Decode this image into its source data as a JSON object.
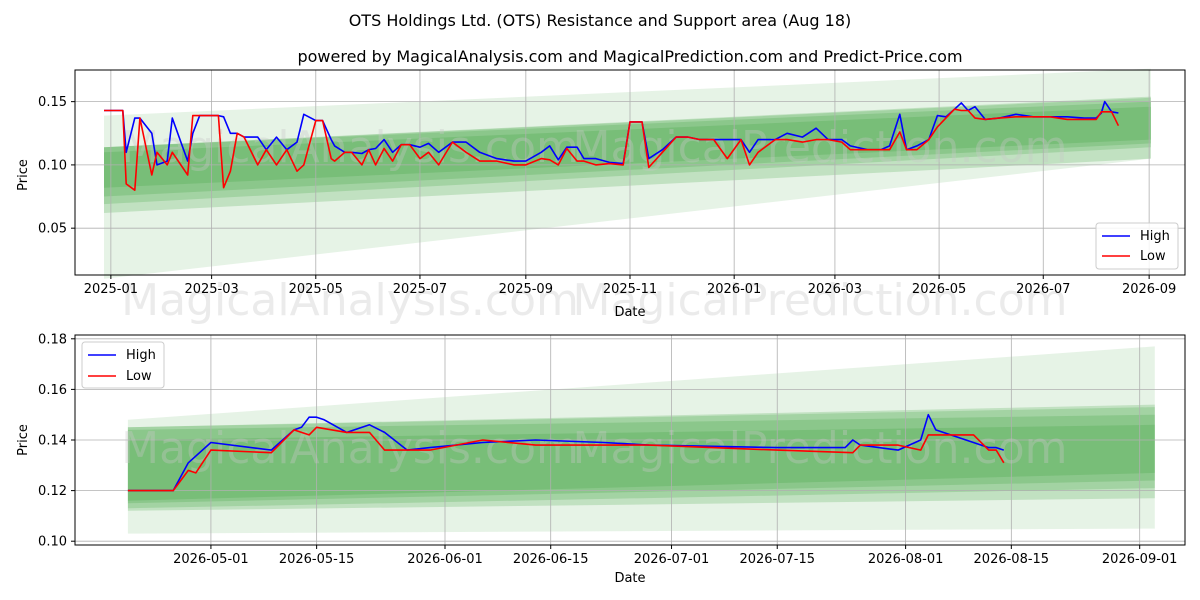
{
  "title": "OTS Holdings Ltd. (OTS) Resistance and Support area (Aug 18)",
  "subtitle": "powered by MagicalAnalysis.com and MagicalPrediction.com and Predict-Price.com",
  "watermarks": [
    "MagicalAnalysis.com",
    "MagicalPrediction.com"
  ],
  "colors": {
    "high": "#0000ff",
    "low": "#ff0000",
    "band": "#2e9a2e",
    "grid": "#b0b0b0"
  },
  "chart_data": [
    {
      "type": "line",
      "xlabel": "Date",
      "ylabel": "Price",
      "xlim": [
        "2024-12-11",
        "2026-09-22"
      ],
      "ylim": [
        0.013,
        0.175
      ],
      "grid": true,
      "legend_placement": "bottom-right",
      "x_ticks": [
        "2025-01",
        "2025-03",
        "2025-05",
        "2025-07",
        "2025-09",
        "2025-11",
        "2026-01",
        "2026-03",
        "2026-05",
        "2026-07",
        "2026-09"
      ],
      "y_ticks": [
        "0.05",
        "0.10",
        "0.15"
      ],
      "series": [
        {
          "name": "High",
          "x": [
            "2024-12-28",
            "2025-01-08",
            "2025-01-10",
            "2025-01-15",
            "2025-01-18",
            "2025-01-25",
            "2025-01-28",
            "2025-02-03",
            "2025-02-06",
            "2025-02-15",
            "2025-02-18",
            "2025-02-22",
            "2025-03-05",
            "2025-03-08",
            "2025-03-12",
            "2025-03-16",
            "2025-03-20",
            "2025-03-28",
            "2025-04-02",
            "2025-04-08",
            "2025-04-14",
            "2025-04-20",
            "2025-04-24",
            "2025-05-01",
            "2025-05-05",
            "2025-05-10",
            "2025-05-12",
            "2025-05-18",
            "2025-05-22",
            "2025-05-28",
            "2025-06-01",
            "2025-06-05",
            "2025-06-10",
            "2025-06-15",
            "2025-06-20",
            "2025-06-25",
            "2025-07-01",
            "2025-07-06",
            "2025-07-12",
            "2025-07-20",
            "2025-07-28",
            "2025-08-05",
            "2025-08-15",
            "2025-08-25",
            "2025-09-01",
            "2025-09-10",
            "2025-09-15",
            "2025-09-20",
            "2025-09-25",
            "2025-10-01",
            "2025-10-05",
            "2025-10-12",
            "2025-10-20",
            "2025-10-28",
            "2025-11-01",
            "2025-11-08",
            "2025-11-12",
            "2025-11-20",
            "2025-11-28",
            "2025-12-05",
            "2025-12-12",
            "2025-12-20",
            "2025-12-28",
            "2026-01-05",
            "2026-01-10",
            "2026-01-15",
            "2026-01-25",
            "2026-02-01",
            "2026-02-10",
            "2026-02-18",
            "2026-02-25",
            "2026-03-05",
            "2026-03-10",
            "2026-03-20",
            "2026-03-28",
            "2026-04-02",
            "2026-04-08",
            "2026-04-12",
            "2026-04-18",
            "2026-04-25",
            "2026-04-30",
            "2026-05-05",
            "2026-05-10",
            "2026-05-14",
            "2026-05-18",
            "2026-05-22",
            "2026-05-28",
            "2026-06-05",
            "2026-06-15",
            "2026-06-25",
            "2026-07-05",
            "2026-07-15",
            "2026-07-25",
            "2026-08-01",
            "2026-08-04",
            "2026-08-06",
            "2026-08-10",
            "2026-08-14"
          ],
          "values": [
            0.143,
            0.143,
            0.11,
            0.137,
            0.137,
            0.125,
            0.1,
            0.103,
            0.137,
            0.103,
            0.125,
            0.139,
            0.139,
            0.138,
            0.125,
            0.125,
            0.122,
            0.122,
            0.112,
            0.122,
            0.112,
            0.118,
            0.14,
            0.135,
            0.135,
            0.12,
            0.115,
            0.11,
            0.11,
            0.109,
            0.112,
            0.113,
            0.12,
            0.11,
            0.116,
            0.116,
            0.114,
            0.117,
            0.11,
            0.118,
            0.118,
            0.11,
            0.105,
            0.103,
            0.103,
            0.11,
            0.115,
            0.104,
            0.114,
            0.114,
            0.105,
            0.105,
            0.102,
            0.101,
            0.134,
            0.134,
            0.105,
            0.112,
            0.122,
            0.122,
            0.12,
            0.12,
            0.12,
            0.12,
            0.11,
            0.12,
            0.12,
            0.125,
            0.122,
            0.129,
            0.12,
            0.12,
            0.115,
            0.112,
            0.112,
            0.115,
            0.14,
            0.112,
            0.115,
            0.12,
            0.139,
            0.138,
            0.144,
            0.149,
            0.143,
            0.146,
            0.136,
            0.137,
            0.14,
            0.138,
            0.138,
            0.138,
            0.137,
            0.137,
            0.141,
            0.15,
            0.142,
            0.141
          ]
        },
        {
          "name": "Low",
          "x": [
            "2024-12-28",
            "2025-01-08",
            "2025-01-10",
            "2025-01-15",
            "2025-01-18",
            "2025-01-25",
            "2025-01-28",
            "2025-02-03",
            "2025-02-06",
            "2025-02-15",
            "2025-02-18",
            "2025-02-22",
            "2025-03-05",
            "2025-03-08",
            "2025-03-12",
            "2025-03-16",
            "2025-03-20",
            "2025-03-28",
            "2025-04-02",
            "2025-04-08",
            "2025-04-14",
            "2025-04-20",
            "2025-04-24",
            "2025-05-01",
            "2025-05-05",
            "2025-05-10",
            "2025-05-12",
            "2025-05-18",
            "2025-05-22",
            "2025-05-28",
            "2025-06-01",
            "2025-06-05",
            "2025-06-10",
            "2025-06-15",
            "2025-06-20",
            "2025-06-25",
            "2025-07-01",
            "2025-07-06",
            "2025-07-12",
            "2025-07-20",
            "2025-07-28",
            "2025-08-05",
            "2025-08-15",
            "2025-08-25",
            "2025-09-01",
            "2025-09-10",
            "2025-09-15",
            "2025-09-20",
            "2025-09-25",
            "2025-10-01",
            "2025-10-05",
            "2025-10-12",
            "2025-10-20",
            "2025-10-28",
            "2025-11-01",
            "2025-11-08",
            "2025-11-12",
            "2025-11-20",
            "2025-11-28",
            "2025-12-05",
            "2025-12-12",
            "2025-12-20",
            "2025-12-28",
            "2026-01-05",
            "2026-01-10",
            "2026-01-15",
            "2026-01-25",
            "2026-02-01",
            "2026-02-10",
            "2026-02-18",
            "2026-02-25",
            "2026-03-05",
            "2026-03-10",
            "2026-03-20",
            "2026-03-28",
            "2026-04-02",
            "2026-04-08",
            "2026-04-12",
            "2026-04-18",
            "2026-04-25",
            "2026-04-30",
            "2026-05-05",
            "2026-05-10",
            "2026-05-14",
            "2026-05-18",
            "2026-05-22",
            "2026-05-28",
            "2026-06-05",
            "2026-06-15",
            "2026-06-25",
            "2026-07-05",
            "2026-07-15",
            "2026-07-25",
            "2026-08-01",
            "2026-08-04",
            "2026-08-06",
            "2026-08-10",
            "2026-08-14"
          ],
          "values": [
            0.143,
            0.143,
            0.085,
            0.08,
            0.137,
            0.092,
            0.11,
            0.1,
            0.11,
            0.092,
            0.139,
            0.139,
            0.139,
            0.082,
            0.095,
            0.125,
            0.122,
            0.1,
            0.112,
            0.1,
            0.112,
            0.095,
            0.1,
            0.135,
            0.135,
            0.105,
            0.103,
            0.11,
            0.11,
            0.1,
            0.112,
            0.1,
            0.113,
            0.103,
            0.116,
            0.116,
            0.105,
            0.11,
            0.1,
            0.118,
            0.11,
            0.103,
            0.103,
            0.1,
            0.1,
            0.105,
            0.104,
            0.1,
            0.113,
            0.103,
            0.103,
            0.1,
            0.101,
            0.1,
            0.134,
            0.134,
            0.098,
            0.11,
            0.122,
            0.122,
            0.12,
            0.12,
            0.105,
            0.12,
            0.1,
            0.11,
            0.12,
            0.12,
            0.118,
            0.12,
            0.12,
            0.118,
            0.112,
            0.112,
            0.112,
            0.112,
            0.126,
            0.112,
            0.112,
            0.12,
            0.13,
            0.137,
            0.144,
            0.143,
            0.143,
            0.137,
            0.136,
            0.137,
            0.138,
            0.138,
            0.138,
            0.136,
            0.136,
            0.136,
            0.142,
            0.142,
            0.142,
            0.131
          ]
        }
      ],
      "bands": [
        {
          "upper_start": 0.139,
          "upper_end": 0.176,
          "lower_start": 0.01,
          "lower_end": 0.105
        },
        {
          "upper_start": 0.114,
          "upper_end": 0.154,
          "lower_start": 0.062,
          "lower_end": 0.105
        },
        {
          "upper_start": 0.114,
          "upper_end": 0.153,
          "lower_start": 0.069,
          "lower_end": 0.114
        },
        {
          "upper_start": 0.114,
          "upper_end": 0.15,
          "lower_start": 0.075,
          "lower_end": 0.117
        },
        {
          "upper_start": 0.11,
          "upper_end": 0.146,
          "lower_start": 0.082,
          "lower_end": 0.12
        }
      ],
      "band_x": [
        "2024-12-28",
        "2026-09-02"
      ]
    },
    {
      "type": "line",
      "xlabel": "Date",
      "ylabel": "Price",
      "xlim": [
        "2026-04-13",
        "2026-09-07"
      ],
      "ylim": [
        0.0985,
        0.1815
      ],
      "grid": true,
      "legend_placement": "top-left",
      "x_ticks": [
        "2026-05-01",
        "2026-05-15",
        "2026-06-01",
        "2026-06-15",
        "2026-07-01",
        "2026-07-15",
        "2026-08-01",
        "2026-08-15",
        "2026-09-01"
      ],
      "y_ticks": [
        "0.10",
        "0.12",
        "0.14",
        "0.16",
        "0.18"
      ],
      "series": [
        {
          "name": "High",
          "x": [
            "2026-04-20",
            "2026-04-26",
            "2026-04-28",
            "2026-05-01",
            "2026-05-09",
            "2026-05-12",
            "2026-05-13",
            "2026-05-14",
            "2026-05-15",
            "2026-05-16",
            "2026-05-19",
            "2026-05-22",
            "2026-05-24",
            "2026-05-27",
            "2026-05-30",
            "2026-06-06",
            "2026-06-13",
            "2026-06-22",
            "2026-06-28",
            "2026-07-15",
            "2026-07-24",
            "2026-07-25",
            "2026-07-26",
            "2026-07-31",
            "2026-08-03",
            "2026-08-04",
            "2026-08-05",
            "2026-08-12",
            "2026-08-13",
            "2026-08-14"
          ],
          "values": [
            0.12,
            0.12,
            0.131,
            0.139,
            0.136,
            0.144,
            0.145,
            0.149,
            0.149,
            0.148,
            0.143,
            0.146,
            0.143,
            0.136,
            0.137,
            0.139,
            0.14,
            0.139,
            0.138,
            0.137,
            0.137,
            0.14,
            0.138,
            0.136,
            0.14,
            0.15,
            0.144,
            0.137,
            0.137,
            0.136
          ]
        },
        {
          "name": "Low",
          "x": [
            "2026-04-20",
            "2026-04-26",
            "2026-04-28",
            "2026-04-29",
            "2026-05-01",
            "2026-05-09",
            "2026-05-12",
            "2026-05-13",
            "2026-05-14",
            "2026-05-15",
            "2026-05-19",
            "2026-05-22",
            "2026-05-24",
            "2026-05-27",
            "2026-05-30",
            "2026-06-06",
            "2026-06-13",
            "2026-06-22",
            "2026-06-28",
            "2026-07-15",
            "2026-07-25",
            "2026-07-26",
            "2026-07-31",
            "2026-08-03",
            "2026-08-04",
            "2026-08-10",
            "2026-08-12",
            "2026-08-13",
            "2026-08-14"
          ],
          "values": [
            0.12,
            0.12,
            0.128,
            0.127,
            0.136,
            0.135,
            0.144,
            0.143,
            0.142,
            0.145,
            0.143,
            0.143,
            0.136,
            0.136,
            0.136,
            0.14,
            0.138,
            0.138,
            0.138,
            0.136,
            0.135,
            0.138,
            0.138,
            0.136,
            0.142,
            0.142,
            0.136,
            0.136,
            0.131
          ]
        }
      ],
      "bands": [
        {
          "upper_start": 0.148,
          "upper_end": 0.177,
          "lower_start": 0.103,
          "lower_end": 0.105
        },
        {
          "upper_start": 0.145,
          "upper_end": 0.154,
          "lower_start": 0.112,
          "lower_end": 0.117
        },
        {
          "upper_start": 0.145,
          "upper_end": 0.153,
          "lower_start": 0.113,
          "lower_end": 0.121
        },
        {
          "upper_start": 0.144,
          "upper_end": 0.15,
          "lower_start": 0.115,
          "lower_end": 0.124
        },
        {
          "upper_start": 0.14,
          "upper_end": 0.146,
          "lower_start": 0.116,
          "lower_end": 0.127
        }
      ],
      "band_x": [
        "2026-04-20",
        "2026-09-03"
      ]
    }
  ]
}
